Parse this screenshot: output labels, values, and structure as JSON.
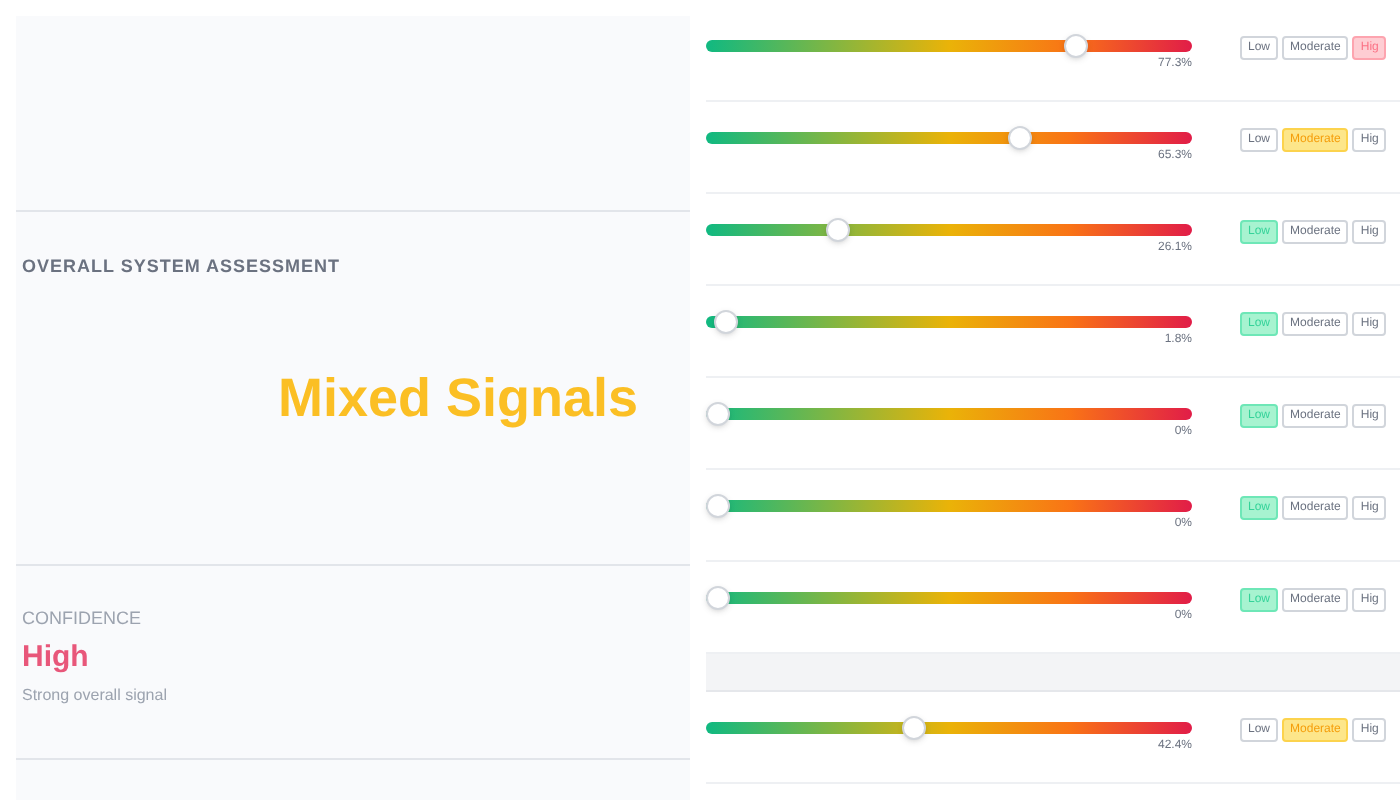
{
  "assessment": {
    "heading": "OVERALL SYSTEM ASSESSMENT",
    "verdict": "Mixed Signals"
  },
  "confidence": {
    "label": "CONFIDENCE",
    "value": "High",
    "note": "Strong overall signal"
  },
  "indicators": [
    {
      "level": 0.773,
      "reading": "77.3%",
      "badges": [
        {
          "kind": "low",
          "label": "Low",
          "selected": false
        },
        {
          "kind": "moderate",
          "label": "Moderate",
          "selected": false
        },
        {
          "kind": "high",
          "label": "Hig",
          "selected": true
        }
      ]
    },
    {
      "level": 0.653,
      "reading": "65.3%",
      "badges": [
        {
          "kind": "low",
          "label": "Low",
          "selected": false
        },
        {
          "kind": "moderate",
          "label": "Moderate",
          "selected": true
        },
        {
          "kind": "high",
          "label": "Hig",
          "selected": false
        }
      ]
    },
    {
      "level": 0.261,
      "reading": "26.1%",
      "badges": [
        {
          "kind": "low",
          "label": "Low",
          "selected": true
        },
        {
          "kind": "moderate",
          "label": "Moderate",
          "selected": false
        },
        {
          "kind": "high",
          "label": "Hig",
          "selected": false
        }
      ]
    },
    {
      "level": 0.018,
      "reading": "1.8%",
      "badges": [
        {
          "kind": "low",
          "label": "Low",
          "selected": true
        },
        {
          "kind": "moderate",
          "label": "Moderate",
          "selected": false
        },
        {
          "kind": "high",
          "label": "Hig",
          "selected": false
        }
      ]
    },
    {
      "level": 0,
      "reading": "0%",
      "badges": [
        {
          "kind": "low",
          "label": "Low",
          "selected": true
        },
        {
          "kind": "moderate",
          "label": "Moderate",
          "selected": false
        },
        {
          "kind": "high",
          "label": "Hig",
          "selected": false
        }
      ]
    },
    {
      "level": 0,
      "reading": "0%",
      "badges": [
        {
          "kind": "low",
          "label": "Low",
          "selected": true
        },
        {
          "kind": "moderate",
          "label": "Moderate",
          "selected": false
        },
        {
          "kind": "high",
          "label": "Hig",
          "selected": false
        }
      ]
    },
    {
      "level": 0,
      "reading": "0%",
      "badges": [
        {
          "kind": "low",
          "label": "Low",
          "selected": true
        },
        {
          "kind": "moderate",
          "label": "Moderate",
          "selected": false
        },
        {
          "kind": "high",
          "label": "Hig",
          "selected": false
        }
      ]
    },
    {
      "level": 0.424,
      "reading": "42.4%",
      "badges": [
        {
          "kind": "low",
          "label": "Low",
          "selected": false
        },
        {
          "kind": "moderate",
          "label": "Moderate",
          "selected": true
        },
        {
          "kind": "high",
          "label": "Hig",
          "selected": false
        }
      ]
    }
  ]
}
